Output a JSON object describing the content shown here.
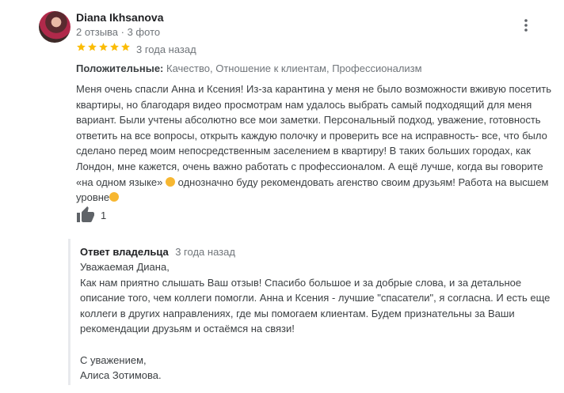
{
  "author": {
    "name": "Diana Ikhsanova",
    "meta": "2 отзыва · 3 фото"
  },
  "rating": {
    "value": 5,
    "max": 5,
    "time": "3 года назад"
  },
  "positives": {
    "label": "Положительные:",
    "items": "Качество, Отношение к клиентам, Профессионализм"
  },
  "review_lines": [
    "Меня очень спасли Анна и Ксения! Из-за карантина у меня не было возможности вживую посетить",
    "квартиры, но благодаря видео просмотрам нам удалось выбрать самый подходящий для меня",
    "вариант. Были учтены абсолютно все мои заметки. Персональный подход, уважение, готовность",
    "ответить на все вопросы, открыть каждую полочку и проверить все на исправность- все, что было",
    "сделано перед моим непосредственным заселением в квартиру! В таких больших городах, как",
    "Лондон, мне кажется, очень важно работать с профессионалом. А ещё лучше, когда вы говорите",
    "«на одном языке»",
    "однозначно буду рекомендовать агенство своим друзьям! Работа на высшем",
    "уровне"
  ],
  "likes": {
    "count": "1"
  },
  "owner_reply": {
    "label": "Ответ владельца",
    "time": "3 года назад",
    "lines": [
      "Уважаемая Диана,",
      "Как нам приятно слышать Ваш отзыв! Спасибо большое и за добрые слова, и за детальное",
      "описание того, чем коллеги помогли. Анна и Ксения - лучшие \"спасатели\", я согласна. И есть еще",
      "коллеги в других направлениях, где мы помогаем клиентам. Будем признательны за Ваши",
      "рекомендации друзьям и остаёмся на связи!",
      "",
      "С уважением,",
      "Алиса Зотимова."
    ]
  },
  "colors": {
    "star": "#fbbc04",
    "muted": "#70757a",
    "text": "#3c4043"
  },
  "icons": {
    "more": "more-vert-icon",
    "like": "thumb-up-icon",
    "star": "star-icon",
    "emoji": "emoji-icon"
  }
}
